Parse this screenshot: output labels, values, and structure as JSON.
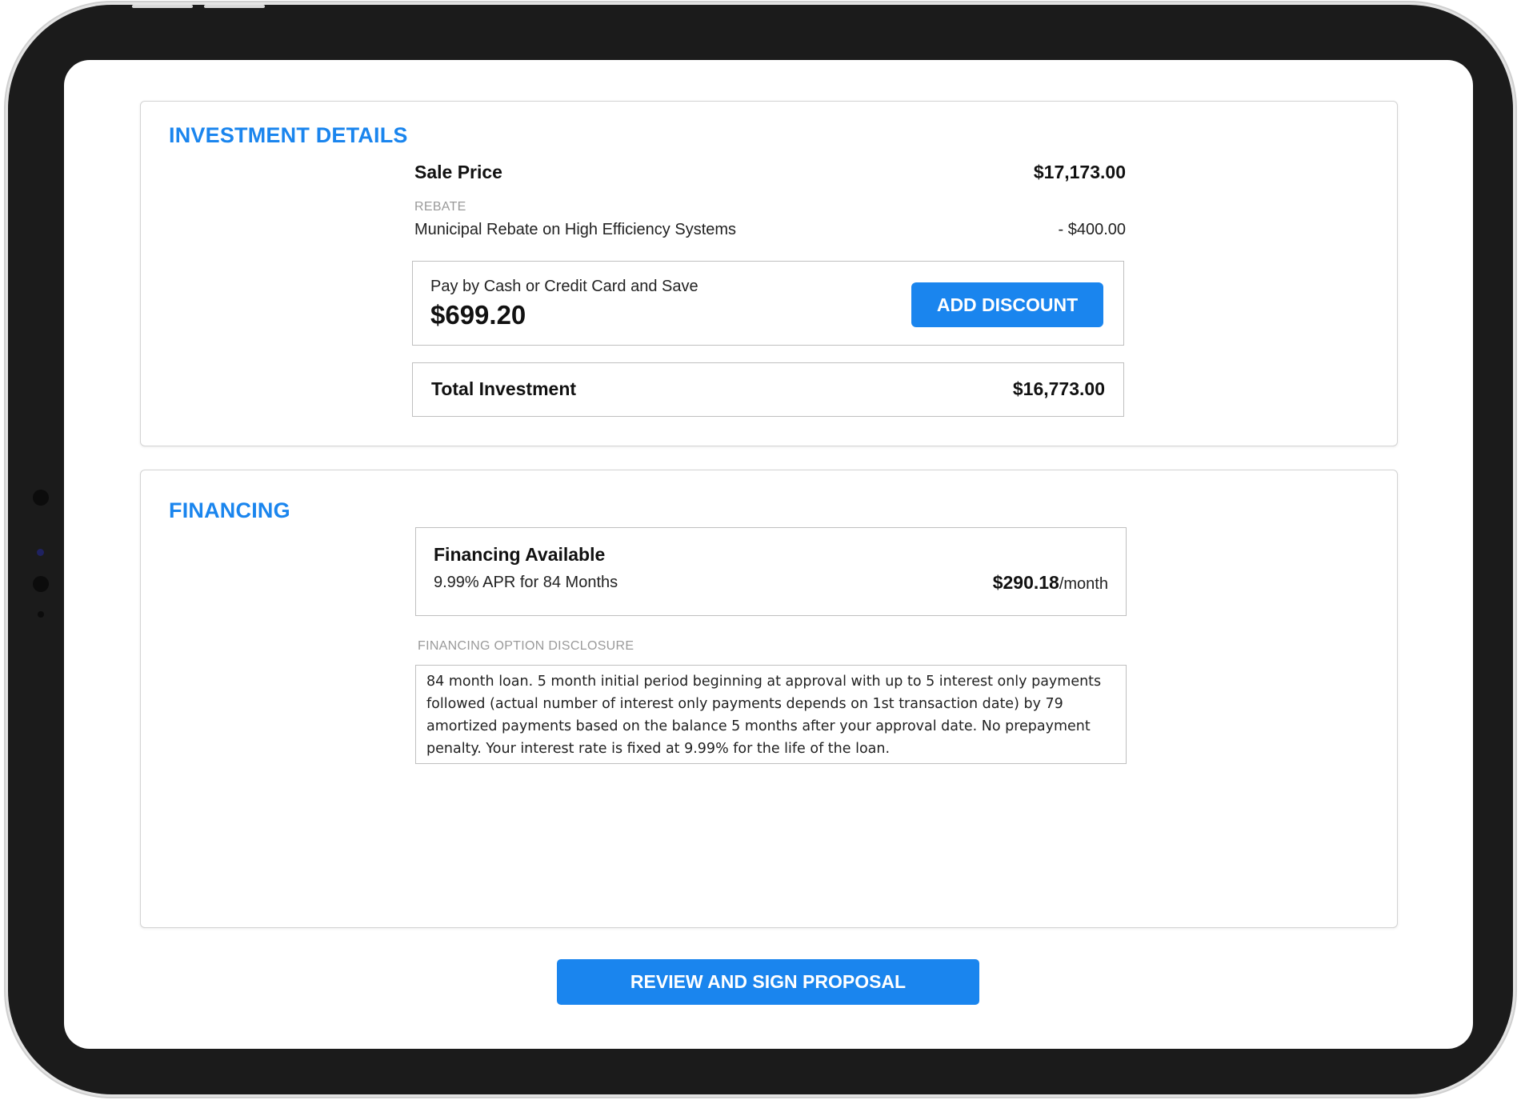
{
  "investment": {
    "title": "INVESTMENT DETAILS",
    "sale_price_label": "Sale Price",
    "sale_price_value": "$17,173.00",
    "rebate_caption": "REBATE",
    "rebate_name": "Municipal Rebate on High Efficiency Systems",
    "rebate_amount": "- $400.00",
    "cash_label": "Pay by Cash or Credit Card and Save",
    "cash_savings": "$699.20",
    "add_discount_label": "ADD DISCOUNT",
    "total_label": "Total Investment",
    "total_value": "$16,773.00"
  },
  "financing": {
    "title": "FINANCING",
    "option_title": "Financing Available",
    "option_terms": "9.99% APR  for 84 Months",
    "monthly_amount": "$290.18",
    "monthly_unit": "/month",
    "disclosure_caption": "FINANCING OPTION DISCLOSURE",
    "disclosure_text": "84 month loan. 5 month initial period beginning at approval with up to 5 interest only payments followed (actual number of interest only payments depends on 1st transaction date) by 79 amortized payments based on the balance 5 months after your approval date. No prepayment penalty. Your interest rate is fixed at 9.99% for the life of the loan."
  },
  "review_button_label": "REVIEW AND SIGN PROPOSAL",
  "colors": {
    "accent": "#1a85ee",
    "bezel": "#1b1b1b",
    "border": "#bfbfbf",
    "caption": "#9a9a9a"
  }
}
